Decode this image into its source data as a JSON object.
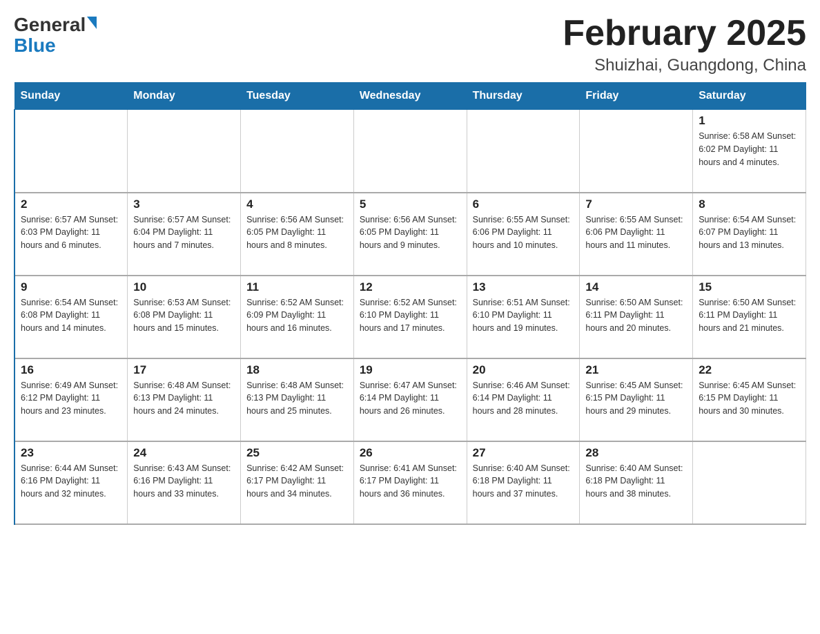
{
  "header": {
    "logo_general": "General",
    "logo_blue": "Blue",
    "month_title": "February 2025",
    "location": "Shuizhai, Guangdong, China"
  },
  "weekdays": [
    "Sunday",
    "Monday",
    "Tuesday",
    "Wednesday",
    "Thursday",
    "Friday",
    "Saturday"
  ],
  "weeks": [
    [
      {
        "day": "",
        "info": ""
      },
      {
        "day": "",
        "info": ""
      },
      {
        "day": "",
        "info": ""
      },
      {
        "day": "",
        "info": ""
      },
      {
        "day": "",
        "info": ""
      },
      {
        "day": "",
        "info": ""
      },
      {
        "day": "1",
        "info": "Sunrise: 6:58 AM\nSunset: 6:02 PM\nDaylight: 11 hours and 4 minutes."
      }
    ],
    [
      {
        "day": "2",
        "info": "Sunrise: 6:57 AM\nSunset: 6:03 PM\nDaylight: 11 hours and 6 minutes."
      },
      {
        "day": "3",
        "info": "Sunrise: 6:57 AM\nSunset: 6:04 PM\nDaylight: 11 hours and 7 minutes."
      },
      {
        "day": "4",
        "info": "Sunrise: 6:56 AM\nSunset: 6:05 PM\nDaylight: 11 hours and 8 minutes."
      },
      {
        "day": "5",
        "info": "Sunrise: 6:56 AM\nSunset: 6:05 PM\nDaylight: 11 hours and 9 minutes."
      },
      {
        "day": "6",
        "info": "Sunrise: 6:55 AM\nSunset: 6:06 PM\nDaylight: 11 hours and 10 minutes."
      },
      {
        "day": "7",
        "info": "Sunrise: 6:55 AM\nSunset: 6:06 PM\nDaylight: 11 hours and 11 minutes."
      },
      {
        "day": "8",
        "info": "Sunrise: 6:54 AM\nSunset: 6:07 PM\nDaylight: 11 hours and 13 minutes."
      }
    ],
    [
      {
        "day": "9",
        "info": "Sunrise: 6:54 AM\nSunset: 6:08 PM\nDaylight: 11 hours and 14 minutes."
      },
      {
        "day": "10",
        "info": "Sunrise: 6:53 AM\nSunset: 6:08 PM\nDaylight: 11 hours and 15 minutes."
      },
      {
        "day": "11",
        "info": "Sunrise: 6:52 AM\nSunset: 6:09 PM\nDaylight: 11 hours and 16 minutes."
      },
      {
        "day": "12",
        "info": "Sunrise: 6:52 AM\nSunset: 6:10 PM\nDaylight: 11 hours and 17 minutes."
      },
      {
        "day": "13",
        "info": "Sunrise: 6:51 AM\nSunset: 6:10 PM\nDaylight: 11 hours and 19 minutes."
      },
      {
        "day": "14",
        "info": "Sunrise: 6:50 AM\nSunset: 6:11 PM\nDaylight: 11 hours and 20 minutes."
      },
      {
        "day": "15",
        "info": "Sunrise: 6:50 AM\nSunset: 6:11 PM\nDaylight: 11 hours and 21 minutes."
      }
    ],
    [
      {
        "day": "16",
        "info": "Sunrise: 6:49 AM\nSunset: 6:12 PM\nDaylight: 11 hours and 23 minutes."
      },
      {
        "day": "17",
        "info": "Sunrise: 6:48 AM\nSunset: 6:13 PM\nDaylight: 11 hours and 24 minutes."
      },
      {
        "day": "18",
        "info": "Sunrise: 6:48 AM\nSunset: 6:13 PM\nDaylight: 11 hours and 25 minutes."
      },
      {
        "day": "19",
        "info": "Sunrise: 6:47 AM\nSunset: 6:14 PM\nDaylight: 11 hours and 26 minutes."
      },
      {
        "day": "20",
        "info": "Sunrise: 6:46 AM\nSunset: 6:14 PM\nDaylight: 11 hours and 28 minutes."
      },
      {
        "day": "21",
        "info": "Sunrise: 6:45 AM\nSunset: 6:15 PM\nDaylight: 11 hours and 29 minutes."
      },
      {
        "day": "22",
        "info": "Sunrise: 6:45 AM\nSunset: 6:15 PM\nDaylight: 11 hours and 30 minutes."
      }
    ],
    [
      {
        "day": "23",
        "info": "Sunrise: 6:44 AM\nSunset: 6:16 PM\nDaylight: 11 hours and 32 minutes."
      },
      {
        "day": "24",
        "info": "Sunrise: 6:43 AM\nSunset: 6:16 PM\nDaylight: 11 hours and 33 minutes."
      },
      {
        "day": "25",
        "info": "Sunrise: 6:42 AM\nSunset: 6:17 PM\nDaylight: 11 hours and 34 minutes."
      },
      {
        "day": "26",
        "info": "Sunrise: 6:41 AM\nSunset: 6:17 PM\nDaylight: 11 hours and 36 minutes."
      },
      {
        "day": "27",
        "info": "Sunrise: 6:40 AM\nSunset: 6:18 PM\nDaylight: 11 hours and 37 minutes."
      },
      {
        "day": "28",
        "info": "Sunrise: 6:40 AM\nSunset: 6:18 PM\nDaylight: 11 hours and 38 minutes."
      },
      {
        "day": "",
        "info": ""
      }
    ]
  ]
}
